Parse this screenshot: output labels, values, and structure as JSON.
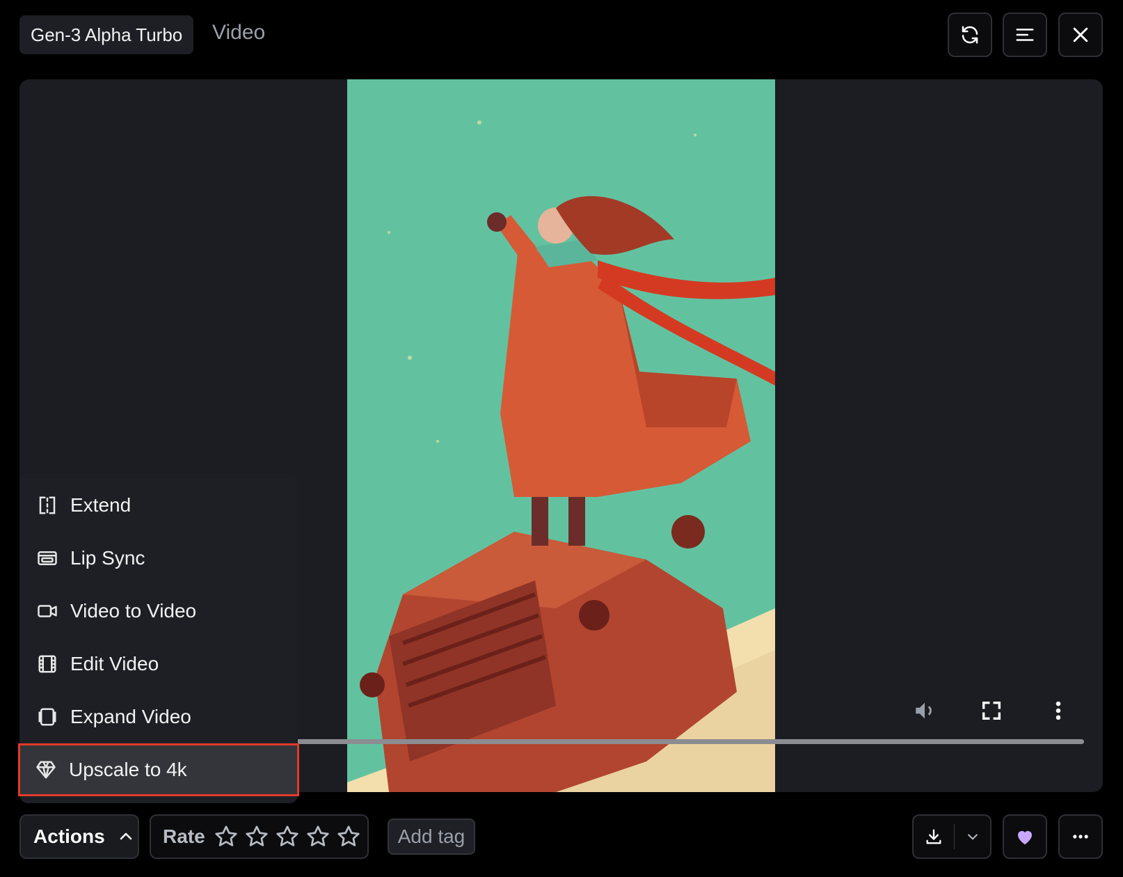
{
  "header": {
    "model_name": "Gen-3 Alpha Turbo",
    "asset_type": "Video",
    "buttons": [
      {
        "name": "refresh-icon"
      },
      {
        "name": "details-menu-icon"
      },
      {
        "name": "close-icon"
      }
    ]
  },
  "viewer": {
    "image_subject": "Illustration of a person in a red coat with a scarf standing on a vintage truck in the snow",
    "controls": [
      "volume-icon",
      "fullscreen-icon",
      "video-more-icon"
    ]
  },
  "actions_menu": {
    "items": [
      {
        "label": "Extend",
        "icon": "extend-icon"
      },
      {
        "label": "Lip Sync",
        "icon": "lip-sync-icon"
      },
      {
        "label": "Video to Video",
        "icon": "video-camera-icon"
      },
      {
        "label": "Edit Video",
        "icon": "film-strip-icon"
      },
      {
        "label": "Expand Video",
        "icon": "expand-frame-icon"
      },
      {
        "label": "Upscale to 4k",
        "icon": "diamond-icon",
        "highlighted": true
      }
    ]
  },
  "footer": {
    "actions_label": "Actions",
    "rate_label": "Rate",
    "rating": 0,
    "max_rating": 5,
    "add_tag_label": "Add tag",
    "favorite_color": "#c9a7ff"
  },
  "colors": {
    "background": "#000000",
    "panel": "#1c1d22",
    "highlight_outline": "#e23a2a",
    "sky": "#62c2a0"
  }
}
